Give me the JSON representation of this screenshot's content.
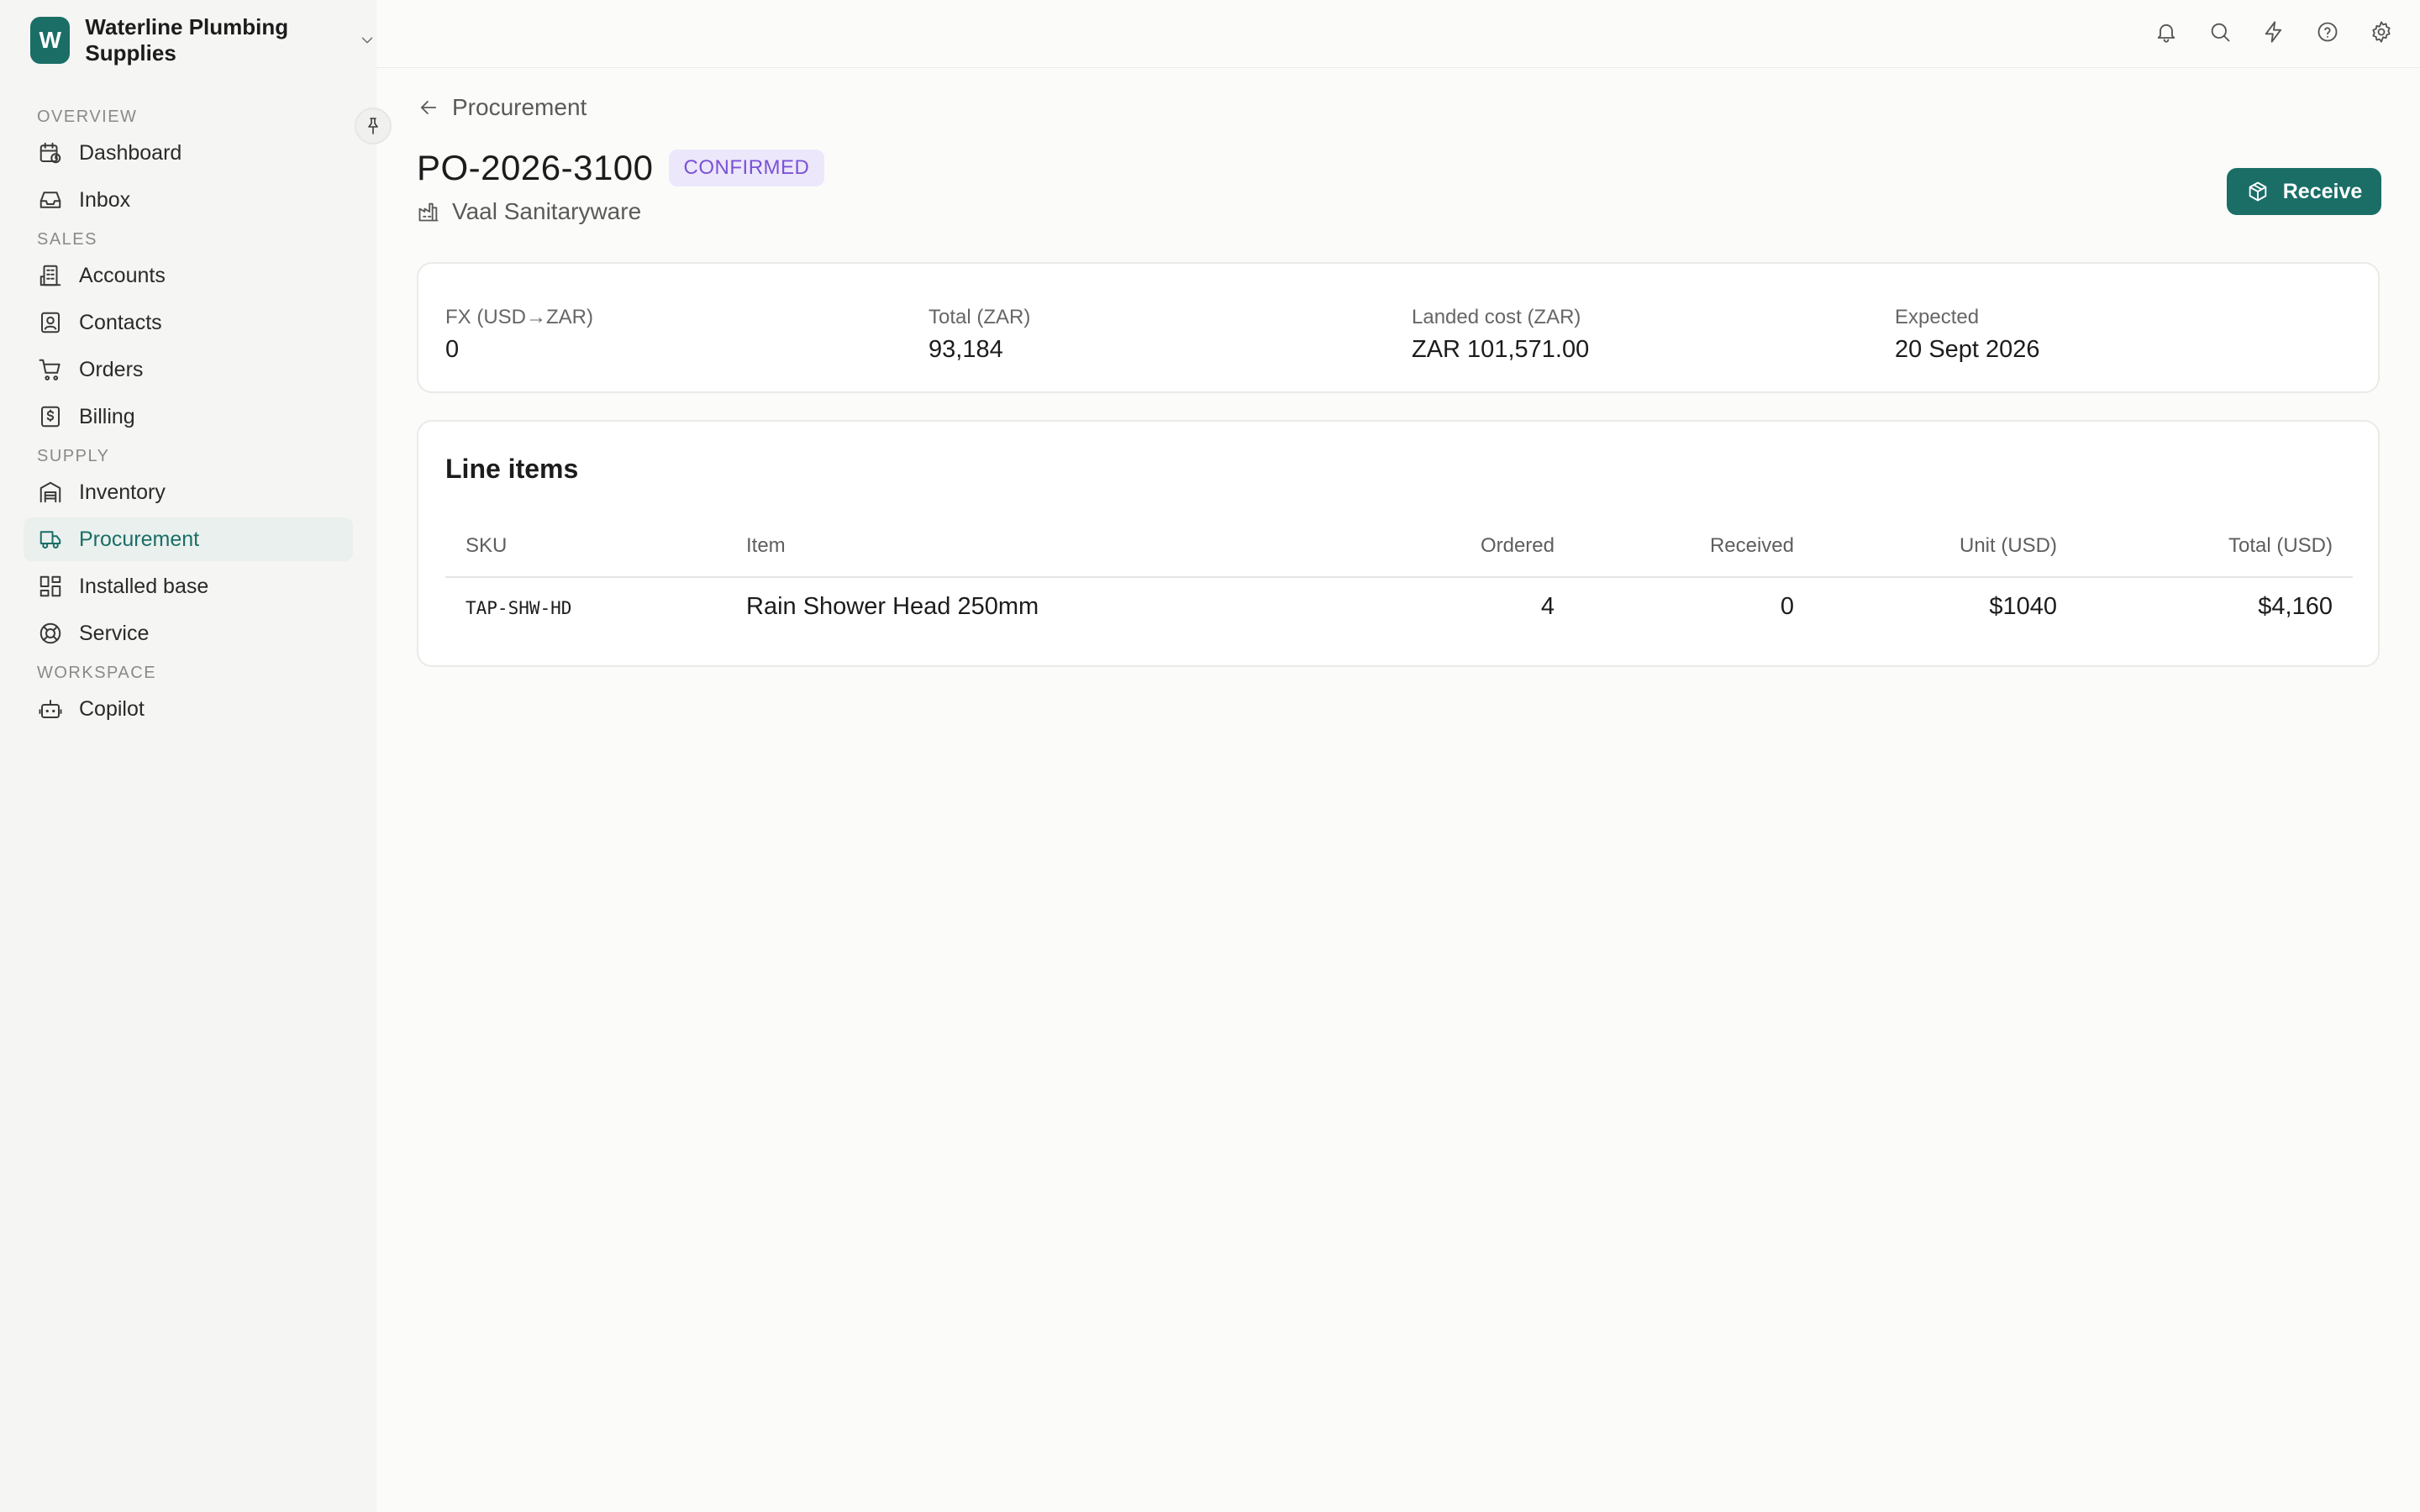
{
  "workspace": {
    "initial": "W",
    "name": "Waterline Plumbing Supplies"
  },
  "nav": {
    "sections": [
      {
        "title": "OVERVIEW",
        "items": [
          {
            "label": "Dashboard",
            "icon": "calendar-clock-icon"
          },
          {
            "label": "Inbox",
            "icon": "inbox-icon"
          }
        ]
      },
      {
        "title": "SALES",
        "items": [
          {
            "label": "Accounts",
            "icon": "building-icon"
          },
          {
            "label": "Contacts",
            "icon": "contact-icon"
          },
          {
            "label": "Orders",
            "icon": "cart-icon"
          },
          {
            "label": "Billing",
            "icon": "dollar-doc-icon"
          }
        ]
      },
      {
        "title": "SUPPLY",
        "items": [
          {
            "label": "Inventory",
            "icon": "warehouse-icon"
          },
          {
            "label": "Procurement",
            "icon": "truck-icon",
            "active": true
          },
          {
            "label": "Installed base",
            "icon": "grid-icon"
          },
          {
            "label": "Service",
            "icon": "lifebuoy-icon"
          }
        ]
      },
      {
        "title": "WORKSPACE",
        "items": [
          {
            "label": "Copilot",
            "icon": "bot-icon"
          }
        ]
      }
    ]
  },
  "header": {
    "back_label": "Procurement",
    "po_number": "PO-2026-3100",
    "status": "CONFIRMED",
    "supplier": "Vaal Sanitaryware",
    "receive_label": "Receive"
  },
  "stats": [
    {
      "label": "FX (USD→ZAR)",
      "value": "0"
    },
    {
      "label": "Total (ZAR)",
      "value": "93,184"
    },
    {
      "label": "Landed cost (ZAR)",
      "value": "ZAR 101,571.00"
    },
    {
      "label": "Expected",
      "value": "20 Sept 2026"
    }
  ],
  "line_items": {
    "title": "Line items",
    "columns": [
      "SKU",
      "Item",
      "Ordered",
      "Received",
      "Unit (USD)",
      "Total (USD)"
    ],
    "rows": [
      {
        "sku": "TAP-SHW-HD",
        "item": "Rain Shower Head 250mm",
        "ordered": "4",
        "received": "0",
        "unit": "$1040",
        "total": "$4,160"
      }
    ]
  },
  "colors": {
    "brand": "#1a6e66",
    "badge_bg": "#ece7fb",
    "badge_text": "#7a52d6"
  }
}
